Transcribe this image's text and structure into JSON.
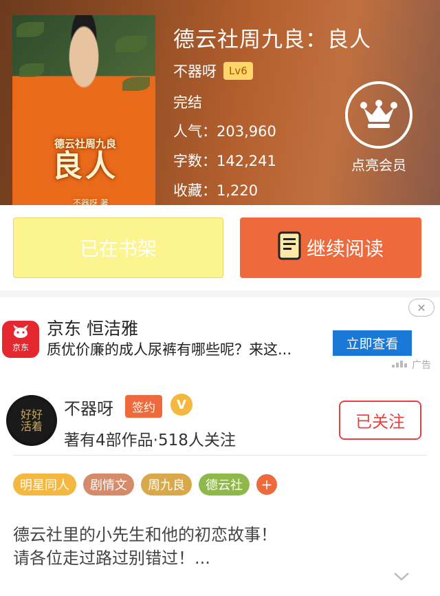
{
  "book": {
    "cover": {
      "title_small": "德云社周九良",
      "title_large": "良人",
      "author_mark": "不器呀 著"
    },
    "title": "德云社周九良：良人",
    "author": "不器呀",
    "level": "Lv6",
    "status": "完结",
    "popularity": "人气：203,960",
    "word_count": "字数：142,241",
    "favorites": "收藏：1,220"
  },
  "vip": {
    "label": "点亮会员",
    "icon": "crown-icon"
  },
  "actions": {
    "shelf_label": "已在书架",
    "read_label": "继续阅读",
    "read_icon": "book-icon"
  },
  "ad": {
    "logo_text": "京东",
    "title": "京东 恒洁雅",
    "desc": "质优价廉的成人尿裤有哪些呢？来这...",
    "button": "立即查看",
    "close": "✕",
    "tag": "广告"
  },
  "author_card": {
    "avatar_text": "好好活着",
    "name": "不器呀",
    "sign_badge": "签约",
    "v_badge": "V",
    "stats": "著有4部作品·518人关注",
    "follow_label": "已关注"
  },
  "tags": [
    {
      "label": "明星同人",
      "color": "#f4b840"
    },
    {
      "label": "剧情文",
      "color": "#d58a6a"
    },
    {
      "label": "周九良",
      "color": "#d9a84a"
    },
    {
      "label": "德云社",
      "color": "#8fb84a"
    }
  ],
  "tags_more": "+",
  "synopsis": {
    "line1": "德云社里的小先生和他的初恋故事！",
    "line2": "请各位走过路过别错过！..."
  },
  "colors": {
    "accent": "#ee6a3c",
    "shelf_bg": "#fbf48f",
    "follow": "#e8413c",
    "ad_button": "#1a79d6"
  }
}
